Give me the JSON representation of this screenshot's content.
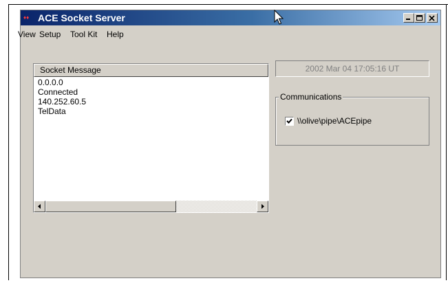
{
  "window": {
    "title": "ACE Socket Server",
    "app_icon_text": "♦♦",
    "caption_buttons": [
      "minimize-icon",
      "maximize-icon",
      "close-icon"
    ]
  },
  "menu": {
    "items": [
      "View",
      "Setup",
      "Tool Kit",
      "Help"
    ]
  },
  "socket_list": {
    "header": "Socket Message",
    "items": [
      "0.0.0.0",
      "Connected",
      "140.252.60.5",
      "TelData"
    ],
    "scroll_left_icon": "arrow-left-icon",
    "scroll_right_icon": "arrow-right-icon",
    "scroll_position": 0.0
  },
  "datetime": "2002 Mar 04  17:05:16 UT",
  "communications": {
    "label": "Communications",
    "pipe": {
      "label": "\\\\olive\\pipe\\ACEpipe",
      "checked": true
    }
  },
  "colors": {
    "window_bg": "#d4d0c8",
    "title_start": "#0a246a",
    "title_end": "#a6caf0",
    "disabled_text": "#808080"
  }
}
